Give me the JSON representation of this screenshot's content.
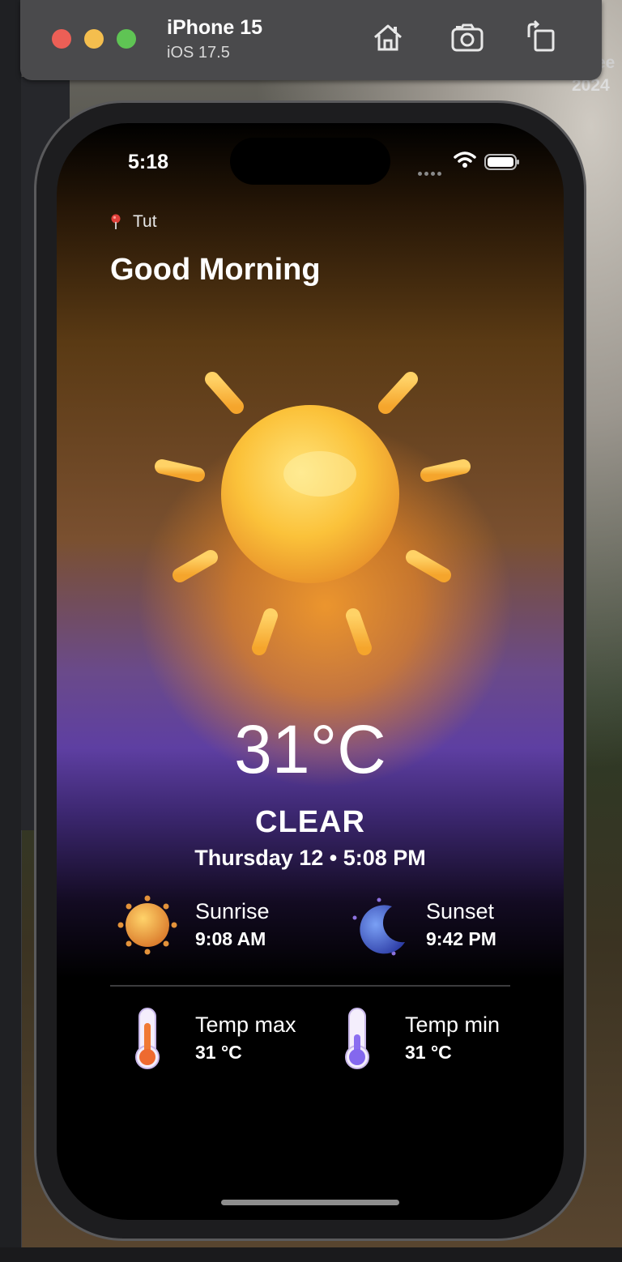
{
  "simulator": {
    "device_name": "iPhone 15",
    "os_version": "iOS 17.5",
    "toolbar_icons": [
      "home-icon",
      "screenshot-icon",
      "rotate-icon"
    ]
  },
  "desktop": {
    "partial_text_top": "ee",
    "partial_text_year": "2024"
  },
  "status_bar": {
    "time": "5:18"
  },
  "location": {
    "name": "Tut",
    "icon": "pin-icon"
  },
  "greeting": "Good Morning",
  "weather": {
    "temperature": "31°C",
    "condition": "CLEAR",
    "date_time": "Thursday 12 • 5:08 PM",
    "icon": "sun-icon"
  },
  "details": {
    "sunrise": {
      "label": "Sunrise",
      "value": "9:08 AM",
      "icon": "sunrise-icon"
    },
    "sunset": {
      "label": "Sunset",
      "value": "9:42 PM",
      "icon": "moon-icon"
    },
    "temp_max": {
      "label": "Temp max",
      "value": "31 °C",
      "icon": "thermometer-hot-icon"
    },
    "temp_min": {
      "label": "Temp min",
      "value": "31 °C",
      "icon": "thermometer-cold-icon"
    }
  },
  "colors": {
    "accent_orange": "#f2992b",
    "accent_purple": "#5e3fa2",
    "background": "#000000"
  }
}
